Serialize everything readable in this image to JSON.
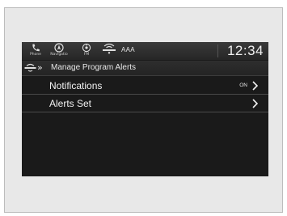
{
  "status_bar": {
    "items": [
      {
        "label": "Phone",
        "icon": "phone-icon"
      },
      {
        "label": "Navigatio",
        "icon": "navigation-icon"
      },
      {
        "label": "FM",
        "icon": "fm-radio-icon"
      },
      {
        "label": "",
        "icon": "signal-icon"
      }
    ],
    "station": "AAA",
    "clock": "12:34"
  },
  "title_bar": {
    "icon": "signal-antenna-icon",
    "breadcrumb_chevron": "»",
    "title": "Manage Program Alerts"
  },
  "menu": {
    "items": [
      {
        "label": "Notifications",
        "state": "ON",
        "icon": "chevron-right-icon"
      },
      {
        "label": "Alerts Set",
        "state": "",
        "icon": "chevron-right-icon"
      }
    ]
  },
  "colors": {
    "screen_background": "#1a1a1a",
    "text": "#f2f2f2",
    "frame": "#e8e8e8"
  }
}
